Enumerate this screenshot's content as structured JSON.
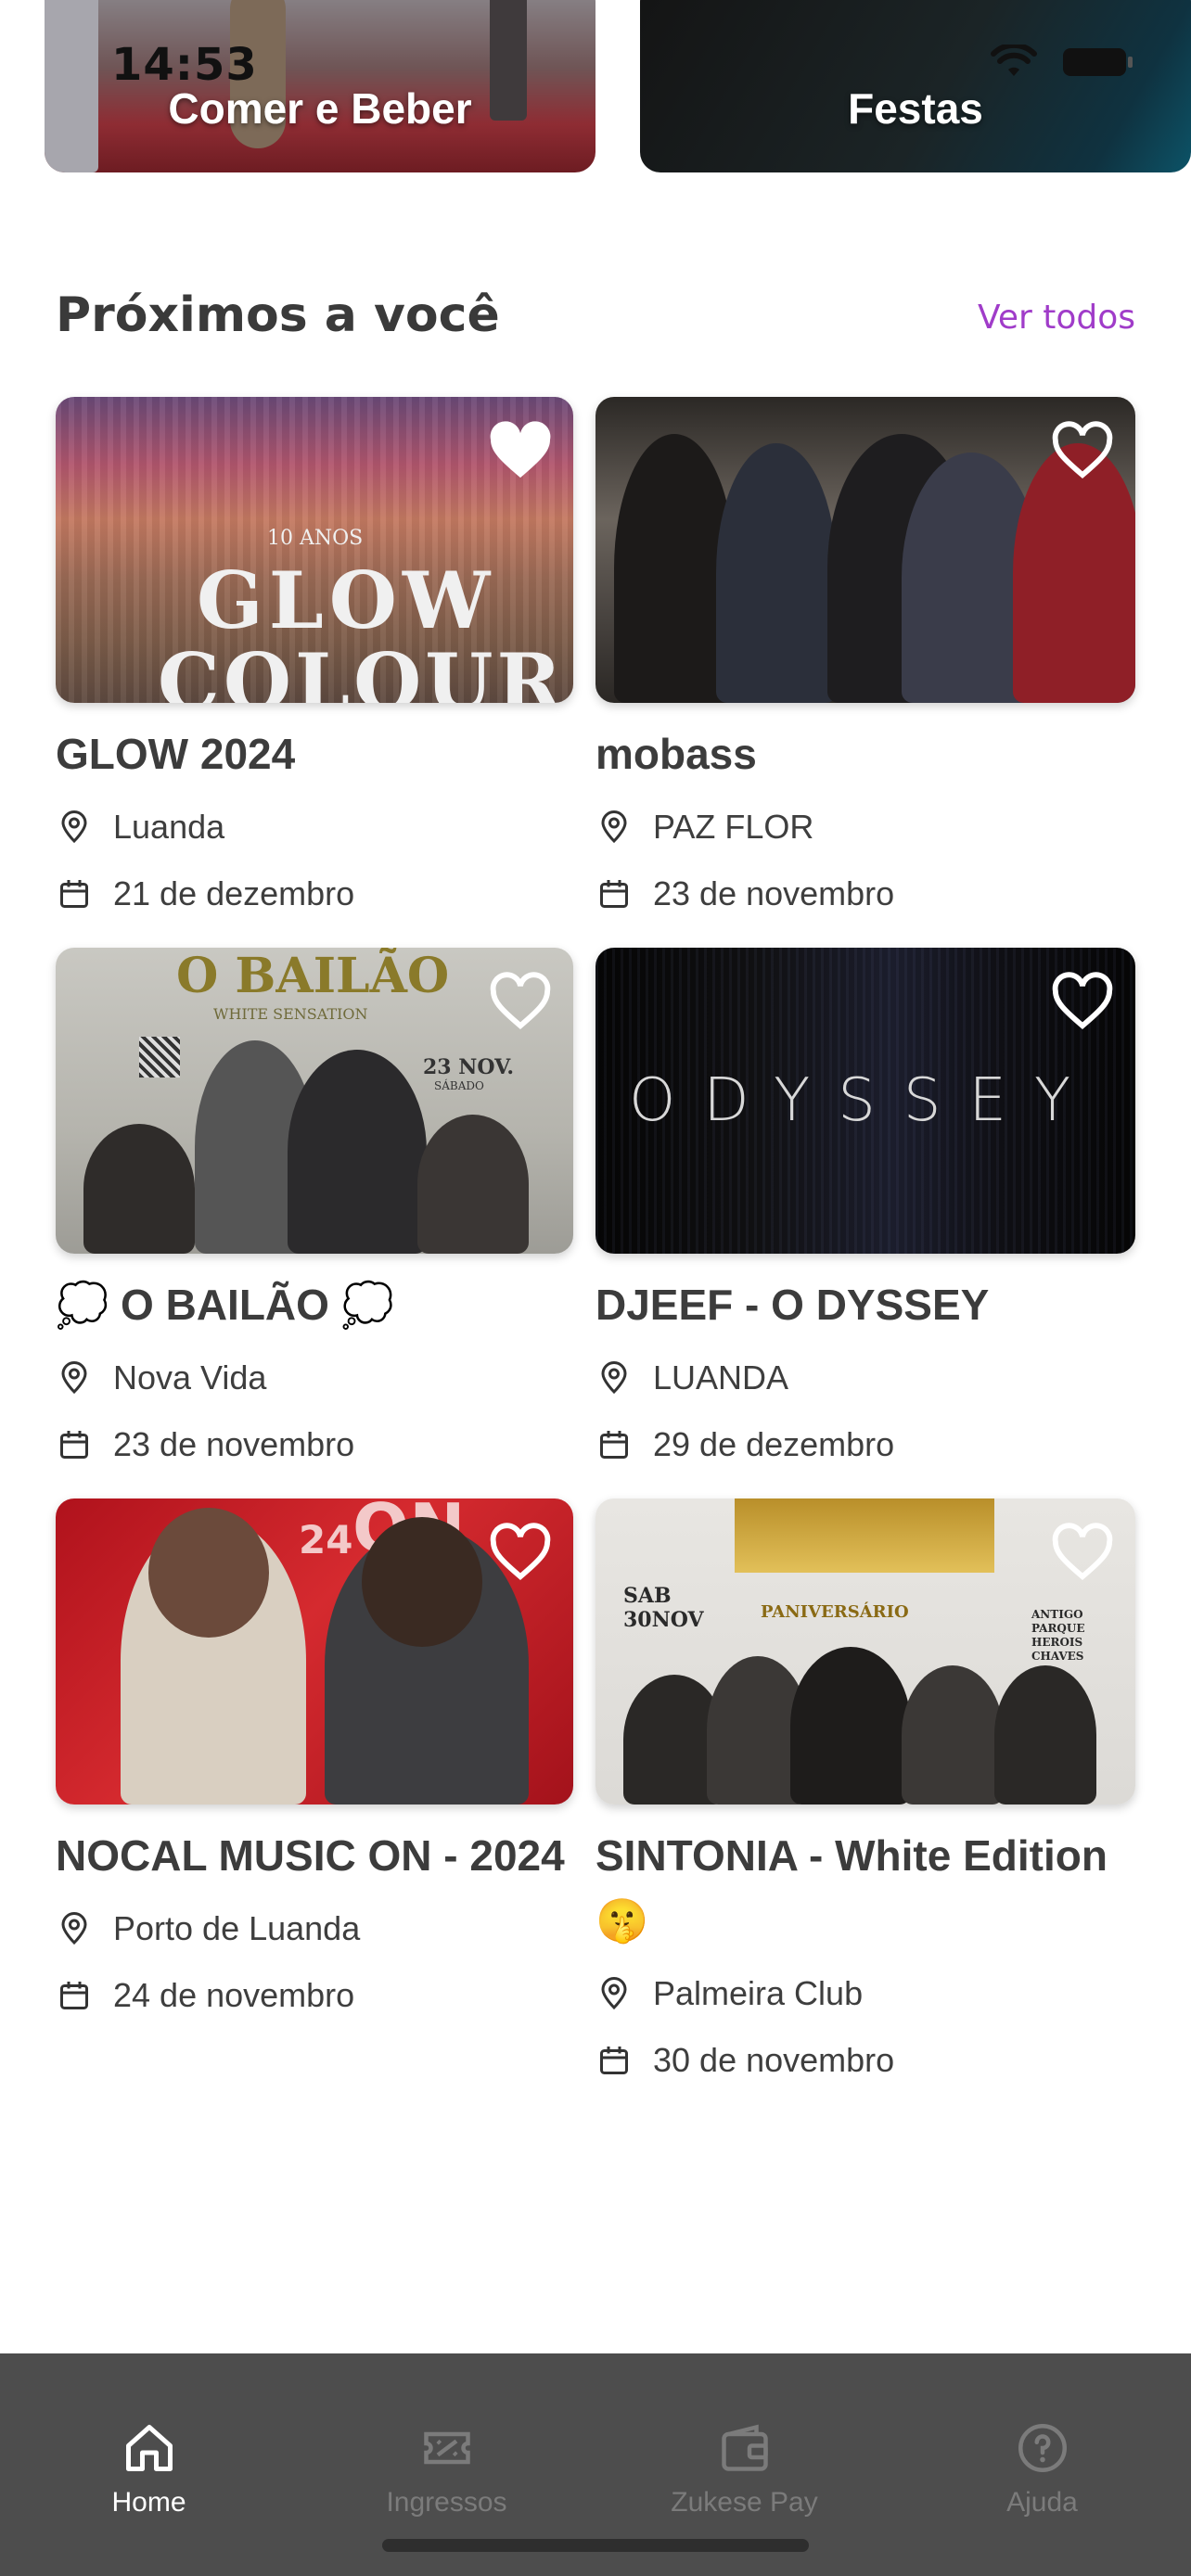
{
  "status_bar": {
    "time": "14:53"
  },
  "categories": [
    {
      "label": "Comer e Beber"
    },
    {
      "label": "Festas"
    }
  ],
  "section": {
    "title": "Próximos a você",
    "see_all": "Ver todos"
  },
  "events": [
    {
      "title": "GLOW 2024",
      "location": "Luanda",
      "date": "21 de dezembro",
      "favorited": true,
      "art_top": "10 ANOS",
      "art_main": "GLOW",
      "art_sub": "COLOUR"
    },
    {
      "title": "mobass",
      "location": "PAZ FLOR",
      "date": "23 de novembro",
      "favorited": false
    },
    {
      "title": "💭 O BAILÃO 💭",
      "location": "Nova Vida",
      "date": "23 de novembro",
      "favorited": false,
      "art_main": "O BAILÃO",
      "art_sub": "WHITE SENSATION",
      "art_date": "23 NOV.",
      "art_day": "SÁBADO"
    },
    {
      "title": "DJEEF - O DYSSEY",
      "location": "LUANDA",
      "date": "29 de dezembro",
      "favorited": false,
      "art_main": "ODYSSEY"
    },
    {
      "title": "NOCAL MUSIC ON - 2024",
      "location": "Porto de Luanda",
      "date": "24 de novembro",
      "favorited": false,
      "art_main": "ON",
      "art_sub": "24"
    },
    {
      "title": "SINTONIA - White Edition 🤫",
      "location": "Palmeira Club",
      "date": "30 de novembro",
      "favorited": false,
      "art_sub": "PANIVERSÁRIO",
      "art_date": "SAB 30NOV",
      "art_venue": "ANTIGO PARQUE HEROIS CHAVES"
    }
  ],
  "bottom_nav": [
    {
      "label": "Home",
      "icon": "home-icon",
      "active": true
    },
    {
      "label": "Ingressos",
      "icon": "ticket-icon",
      "active": false
    },
    {
      "label": "Zukese Pay",
      "icon": "wallet-icon",
      "active": false
    },
    {
      "label": "Ajuda",
      "icon": "help-icon",
      "active": false
    }
  ],
  "colors": {
    "accent": "#a03cc9",
    "nav_bg": "#4d4d4d",
    "text": "#3c3c3c"
  }
}
